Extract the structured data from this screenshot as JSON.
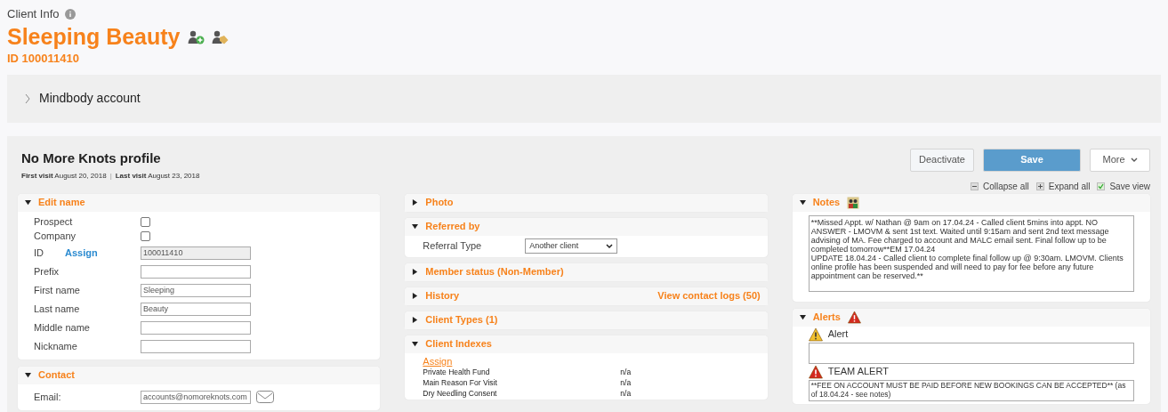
{
  "header": {
    "title": "Client Info",
    "name": "Sleeping Beauty",
    "id_line": "ID 100011410"
  },
  "mindbody": {
    "label": "Mindbody account",
    "expanded": false
  },
  "profile": {
    "title": "No More Knots profile",
    "first_visit_label": "First visit",
    "first_visit": "August 20, 2018",
    "separator": "|",
    "last_visit_label": "Last visit",
    "last_visit": "August 23, 2018"
  },
  "buttons": [
    {
      "label": "Deactivate",
      "kind": "default"
    },
    {
      "label": "Save",
      "kind": "primary"
    },
    {
      "label": "More",
      "kind": "dropdown"
    }
  ],
  "view_controls": [
    {
      "label": "Collapse all",
      "kind": "collapse"
    },
    {
      "label": "Expand all",
      "kind": "expand"
    },
    {
      "label": "Save view",
      "kind": "check",
      "checked": true
    }
  ],
  "left_sections": [
    {
      "title": "Edit name",
      "expanded": true,
      "kind": "form",
      "rows": [
        {
          "kind": "checkbox",
          "label": "Prospect",
          "checked": false
        },
        {
          "kind": "checkbox",
          "label": "Company",
          "checked": false
        },
        {
          "kind": "text",
          "label": "ID",
          "link": "Assign",
          "value": "100011410",
          "disabled": true
        },
        {
          "kind": "text",
          "label": "Prefix",
          "disabled": false
        },
        {
          "kind": "text",
          "label": "First name",
          "value": "Sleeping",
          "disabled": false
        },
        {
          "kind": "text",
          "label": "Last name",
          "value": "Beauty",
          "disabled": false
        },
        {
          "kind": "text",
          "label": "Middle name",
          "disabled": false
        },
        {
          "kind": "text",
          "label": "Nickname",
          "disabled": false
        }
      ]
    },
    {
      "title": "Contact",
      "expanded": true,
      "kind": "form",
      "rows": [
        {
          "kind": "email",
          "label": "Email:",
          "value": "accounts@nomoreknots.com",
          "disabled": false
        }
      ]
    }
  ],
  "middle_sections": [
    {
      "title": "Photo",
      "expanded": false,
      "kind": "plain"
    },
    {
      "title": "Referred by",
      "expanded": true,
      "kind": "select",
      "label": "Referral Type",
      "value": "Another client"
    },
    {
      "title": "Member status (Non-Member)",
      "expanded": false,
      "kind": "plain"
    },
    {
      "title": "History",
      "expanded": false,
      "kind": "plain",
      "link": "View contact logs (50)"
    },
    {
      "title": "Client Types (1)",
      "expanded": false,
      "kind": "plain"
    },
    {
      "title": "Client Indexes",
      "expanded": true,
      "kind": "indexes",
      "assign": "Assign",
      "rows": [
        {
          "name": "Private Health Fund",
          "value": "n/a"
        },
        {
          "name": "Main Reason For Visit",
          "value": "n/a"
        },
        {
          "name": "Dry Needling Consent",
          "value": "n/a"
        }
      ]
    }
  ],
  "right_sections": [
    {
      "title": "Notes",
      "expanded": true,
      "kind": "notes",
      "value": "**Missed Appt. w/ Nathan @ 9am on 17.04.24 - Called client 5mins into appt. NO ANSWER - LMOVM & sent 1st text. Waited until 9:15am and sent 2nd text message advising of MA. Fee charged to account and MALC email sent. Final follow up to be completed tomorrow**EM 17.04.24\nUPDATE 18.04.24 - Called client to complete final follow up @ 9:30am. LMOVM. Clients online profile has been suspended and will need to pay for fee before any future appointment can be reserved.**"
    },
    {
      "title": "Alerts",
      "expanded": true,
      "kind": "alerts",
      "alerts": [
        {
          "label": "Alert",
          "kind": "warning"
        },
        {
          "label": "TEAM ALERT",
          "kind": "danger",
          "value": "**FEE ON ACCOUNT MUST BE PAID BEFORE NEW BOOKINGS CAN BE ACCEPTED** (as of 18.04.24 - see notes)"
        }
      ]
    }
  ]
}
